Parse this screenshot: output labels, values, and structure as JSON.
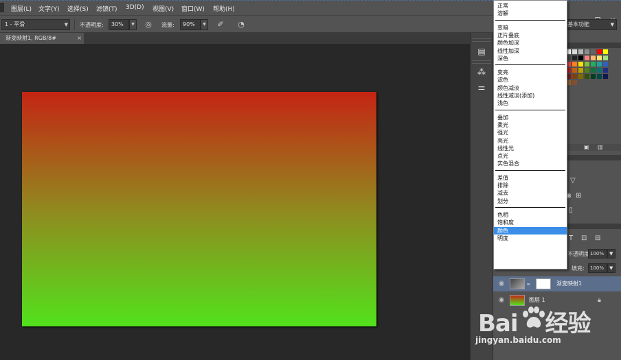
{
  "menubar": {
    "items": [
      {
        "label": "图层(L)"
      },
      {
        "label": "文字(Y)"
      },
      {
        "label": "选择(S)"
      },
      {
        "label": "滤镜(T)"
      },
      {
        "label": "3D(D)"
      },
      {
        "label": "视图(V)"
      },
      {
        "label": "窗口(W)"
      },
      {
        "label": "帮助(H)"
      }
    ]
  },
  "options_bar": {
    "brush_preset": "1 - 平滑",
    "opacity_label": "不透明度:",
    "opacity_value": "30%",
    "flow_label": "流量:",
    "flow_value": "90%"
  },
  "document": {
    "tab_title": "渐变映射1, RGB/8#",
    "gradient": {
      "top": "#c42514",
      "middle": "#8f8c1f",
      "bottom": "#52e21c"
    }
  },
  "workspace": {
    "label": "基本功能"
  },
  "blend_modes": {
    "group1": [
      "正常",
      "溶解"
    ],
    "group2": [
      "变暗",
      "正片叠底",
      "颜色加深",
      "线性加深",
      "深色"
    ],
    "group3": [
      "变亮",
      "滤色",
      "颜色减淡",
      "线性减淡(添加)",
      "浅色"
    ],
    "group4": [
      "叠加",
      "柔光",
      "强光",
      "亮光",
      "线性光",
      "点光",
      "实色混合"
    ],
    "group5": [
      "差值",
      "排除",
      "减去",
      "划分"
    ],
    "group6": [
      "色相",
      "饱和度",
      "颜色",
      "明度"
    ],
    "highlighted": "颜色"
  },
  "layers": {
    "opacity_label": "不透明度:",
    "opacity_value": "100%",
    "fill_label": "填充:",
    "fill_value": "100%",
    "rows": [
      {
        "name": "渐变映射1",
        "selected": true
      },
      {
        "name": "图层 1",
        "selected": false
      }
    ]
  },
  "watermark": {
    "logo_left": "Bai",
    "logo_right": "经验",
    "url": "jingyan.baidu.com"
  },
  "colors": {
    "accent": "#3b8ee8",
    "selected_layer": "#5b6e8c",
    "panel": "#535353"
  }
}
